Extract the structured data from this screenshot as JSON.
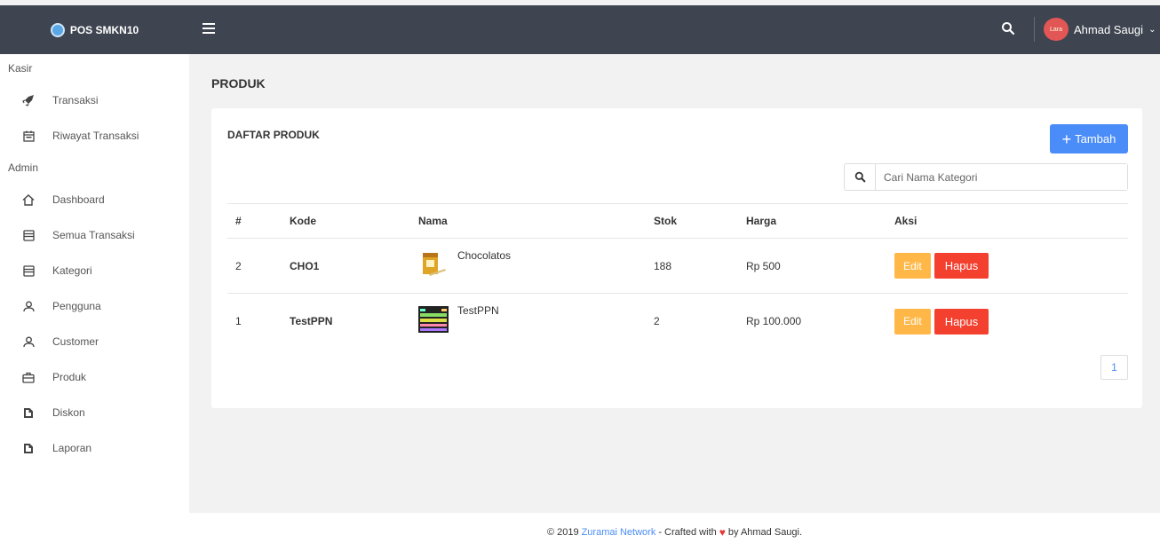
{
  "topbar": {
    "brand": "POS SMKN10",
    "user_name": "Ahmad Saugi",
    "avatar_text": "Lara"
  },
  "sidebar": {
    "sections": [
      {
        "label": "Kasir",
        "items": [
          {
            "label": "Transaksi",
            "icon": "rocket-icon"
          },
          {
            "label": "Riwayat Transaksi",
            "icon": "calendar-icon"
          }
        ]
      },
      {
        "label": "Admin",
        "items": [
          {
            "label": "Dashboard",
            "icon": "home-icon"
          },
          {
            "label": "Semua Transaksi",
            "icon": "inbox-icon"
          },
          {
            "label": "Kategori",
            "icon": "inbox-icon"
          },
          {
            "label": "Pengguna",
            "icon": "user-icon"
          },
          {
            "label": "Customer",
            "icon": "user-icon"
          },
          {
            "label": "Produk",
            "icon": "briefcase-icon"
          },
          {
            "label": "Diskon",
            "icon": "file-icon"
          },
          {
            "label": "Laporan",
            "icon": "file-icon"
          }
        ]
      }
    ]
  },
  "main": {
    "page_title": "PRODUK",
    "card_title": "DAFTAR PRODUK",
    "add_button": "Tambah",
    "search_placeholder": "Cari Nama Kategori",
    "table": {
      "headers": [
        "#",
        "Kode",
        "Nama",
        "Stok",
        "Harga",
        "Aksi"
      ],
      "rows": [
        {
          "no": "2",
          "kode": "CHO1",
          "nama": "Chocolatos",
          "stok": "188",
          "harga": "Rp 500",
          "edit": "Edit",
          "hapus": "Hapus"
        },
        {
          "no": "1",
          "kode": "TestPPN",
          "nama": "TestPPN",
          "stok": "2",
          "harga": "Rp 100.000",
          "edit": "Edit",
          "hapus": "Hapus"
        }
      ]
    },
    "pagination": [
      "1"
    ]
  },
  "footer": {
    "prefix": "© 2019",
    "link": "Zuramai Network",
    "middle": "- Crafted with",
    "suffix": "by Ahmad Saugi."
  },
  "colors": {
    "topbar": "#3e4550",
    "primary": "#4b8df8",
    "warning": "#ffb848",
    "danger": "#f3402f"
  }
}
